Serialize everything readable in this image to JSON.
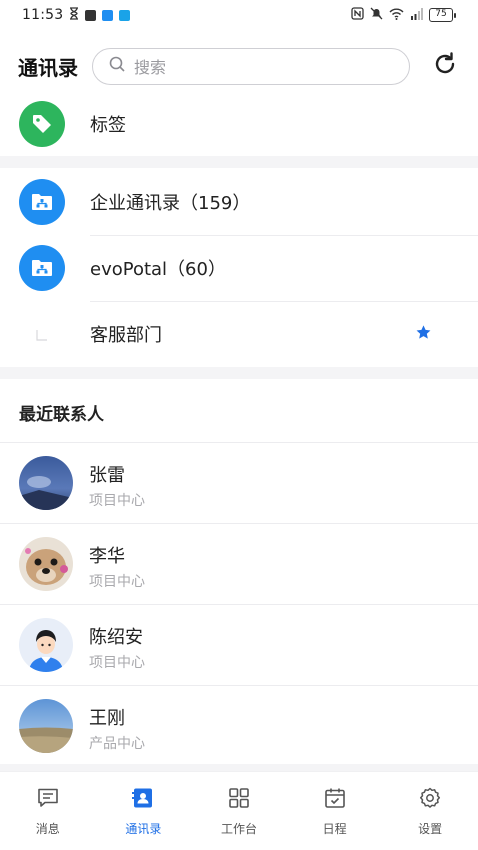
{
  "status_bar": {
    "time": "11:53",
    "battery": "75"
  },
  "header": {
    "title": "通讯录",
    "search_placeholder": "搜索"
  },
  "top_items": [
    {
      "label": "标签",
      "icon": "tag-icon",
      "color": "#2db55d"
    },
    {
      "label": "企业通讯录（159）",
      "icon": "org-folder-icon",
      "color": "#1f8ef1"
    },
    {
      "label": "evoPotal（60）",
      "icon": "org-folder-icon",
      "color": "#1f8ef1"
    },
    {
      "label": "客服部门",
      "icon": "department-icon",
      "starred": true,
      "star_color": "#1f6fe5"
    }
  ],
  "recent": {
    "title": "最近联系人",
    "contacts": [
      {
        "name": "张雷",
        "department": "项目中心",
        "avatar": "landscape-blue"
      },
      {
        "name": "李华",
        "department": "项目中心",
        "avatar": "dog"
      },
      {
        "name": "陈绍安",
        "department": "项目中心",
        "avatar": "cartoon-man"
      },
      {
        "name": "王刚",
        "department": "产品中心",
        "avatar": "field"
      }
    ]
  },
  "bottom_nav": {
    "active_index": 1,
    "accent": "#1f6fe5",
    "items": [
      {
        "label": "消息",
        "icon": "message-icon"
      },
      {
        "label": "通讯录",
        "icon": "contacts-icon"
      },
      {
        "label": "工作台",
        "icon": "grid-icon"
      },
      {
        "label": "日程",
        "icon": "calendar-icon"
      },
      {
        "label": "设置",
        "icon": "settings-icon"
      }
    ]
  }
}
